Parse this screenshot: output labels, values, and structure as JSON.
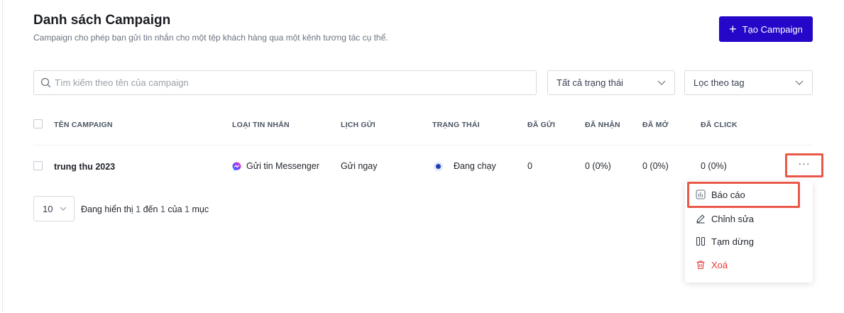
{
  "header": {
    "title": "Danh sách Campaign",
    "subtitle": "Campaign cho phép bạn gửi tin nhắn cho một tệp khách hàng qua một kênh tương tác cụ thể.",
    "create_button": "Tạo Campaign",
    "create_icon": "+",
    "accent_color": "#2407C8"
  },
  "filters": {
    "search_placeholder": "Tìm kiếm theo tên của campaign",
    "status_select": "Tất cả trạng thái",
    "tag_select": "Lọc theo tag"
  },
  "table": {
    "columns": [
      "TÊN CAMPAIGN",
      "LOẠI TIN NHẮN",
      "LỊCH GỬI",
      "TRẠNG THÁI",
      "ĐÃ GỬI",
      "ĐÃ NHẬN",
      "ĐÃ MỞ",
      "ĐÃ CLICK"
    ],
    "rows": [
      {
        "name": "trung thu 2023",
        "channel": "Gửi tin Messenger",
        "channel_icon": "messenger-icon",
        "schedule": "Gửi ngay",
        "status": "Đang chạy",
        "sent": "0",
        "received": "0 (0%)",
        "opened": "0 (0%)",
        "clicked": "0 (0%)",
        "more": "···"
      }
    ]
  },
  "pagination": {
    "page_size": "10",
    "text_prefix": "Đang hiển thị",
    "from": "1",
    "text_to": "đến",
    "to": "1",
    "text_of": "của",
    "total": "1",
    "text_suffix": "mục"
  },
  "row_menu": {
    "items": [
      {
        "label": "Báo cáo",
        "icon": "report-chart-icon"
      },
      {
        "label": "Chỉnh sửa",
        "icon": "pencil-icon"
      },
      {
        "label": "Tạm dừng",
        "icon": "pause-icon"
      },
      {
        "label": "Xoá",
        "icon": "trash-icon",
        "color": "#E53935"
      }
    ]
  }
}
